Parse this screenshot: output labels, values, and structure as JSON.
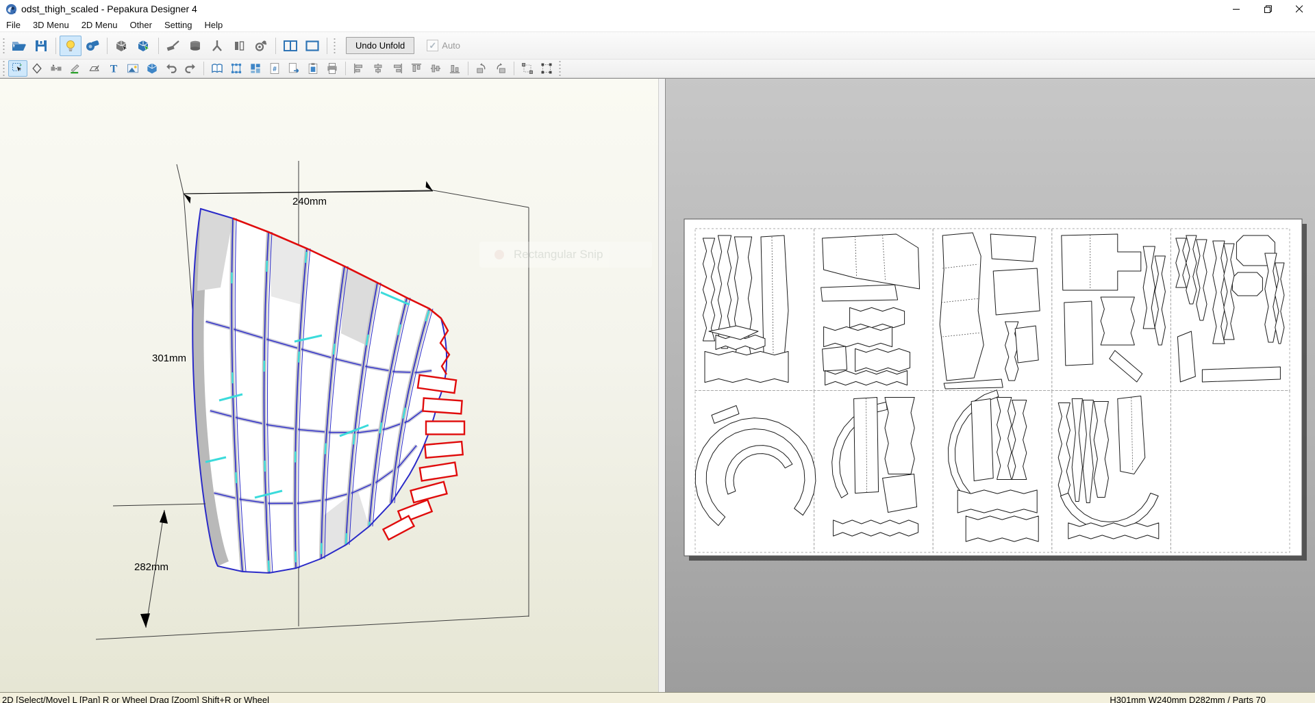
{
  "window": {
    "title": "odst_thigh_scaled - Pepakura Designer 4",
    "controls": [
      {
        "id": "minimize"
      },
      {
        "id": "restore"
      },
      {
        "id": "close"
      }
    ]
  },
  "menubar": {
    "items": [
      "File",
      "3D Menu",
      "2D Menu",
      "Other",
      "Setting",
      "Help"
    ]
  },
  "toolbar_main": {
    "icons": [
      {
        "id": "open-file",
        "active": false
      },
      {
        "id": "save-file",
        "active": false
      },
      {
        "id": "sep"
      },
      {
        "id": "toggle-light",
        "active": true
      },
      {
        "id": "texture-view",
        "active": false
      },
      {
        "id": "sep"
      },
      {
        "id": "select-object-3d",
        "active": false
      },
      {
        "id": "select-part-3d",
        "active": false
      },
      {
        "id": "sep"
      },
      {
        "id": "edit-tool",
        "active": false
      },
      {
        "id": "solid-view",
        "active": false
      },
      {
        "id": "joint-view",
        "active": false
      },
      {
        "id": "texture-settings",
        "active": false
      },
      {
        "id": "view-settings",
        "active": false
      },
      {
        "id": "sep"
      },
      {
        "id": "two-pane-layout",
        "active": false
      },
      {
        "id": "one-pane-layout",
        "active": false
      },
      {
        "id": "sep"
      }
    ],
    "undo_unfold_label": "Undo Unfold",
    "auto_checkbox": {
      "label": "Auto",
      "checked": true,
      "enabled": false
    }
  },
  "toolbar_2d": {
    "icons": [
      {
        "id": "select-move",
        "active": true
      },
      {
        "id": "select-lasso",
        "active": false
      },
      {
        "id": "divide-join",
        "active": false
      },
      {
        "id": "edit-line",
        "active": false
      },
      {
        "id": "edit-flap",
        "active": false
      },
      {
        "id": "insert-text",
        "active": false
      },
      {
        "id": "insert-image",
        "active": false
      },
      {
        "id": "show-3d-box",
        "active": false
      },
      {
        "id": "undo",
        "active": false
      },
      {
        "id": "redo",
        "active": false
      },
      {
        "id": "sep"
      },
      {
        "id": "open-sheet",
        "active": false
      },
      {
        "id": "bounding-select",
        "active": false
      },
      {
        "id": "auto-arrange",
        "active": false
      },
      {
        "id": "page-number",
        "active": false
      },
      {
        "id": "export-page",
        "active": false
      },
      {
        "id": "clipboard",
        "active": false
      },
      {
        "id": "print",
        "active": false
      },
      {
        "id": "sep"
      },
      {
        "id": "align-left",
        "active": false
      },
      {
        "id": "align-center-horizontal",
        "active": false
      },
      {
        "id": "align-right",
        "active": false
      },
      {
        "id": "align-top",
        "active": false
      },
      {
        "id": "align-center-vertical",
        "active": false
      },
      {
        "id": "align-bottom",
        "active": false
      },
      {
        "id": "sep"
      },
      {
        "id": "rotate-left",
        "active": false
      },
      {
        "id": "rotate-right",
        "active": false
      },
      {
        "id": "sep"
      },
      {
        "id": "group-select",
        "active": false
      },
      {
        "id": "ungroup-select",
        "active": false
      }
    ]
  },
  "viewport_3d": {
    "dimension_labels": {
      "width": "240mm",
      "height": "301mm",
      "depth": "282mm"
    },
    "watermark_text": "Rectangular Snip"
  },
  "viewport_2d": {
    "grid": {
      "columns": 5,
      "rows": 2
    },
    "filled_pages": 9,
    "total_pages": 10
  },
  "statusbar": {
    "left_text": "2D [Select/Move] L [Pan] R or Wheel Drag [Zoom] Shift+R or Wheel",
    "right_text": "H301mm W240mm D282mm / Parts 70"
  },
  "colors": {
    "accent_blue": "#2e74b5",
    "icon_gray": "#6f6f6f",
    "active_tool_bg": "#cfe8fb",
    "model_edge": "#2a2ac8",
    "model_open_edge": "#e00c0c",
    "model_accent": "#3bdbdb",
    "paper": "#ffffff"
  }
}
